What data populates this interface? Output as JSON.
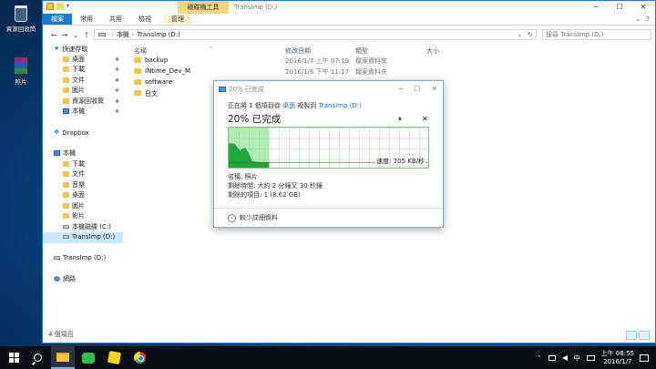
{
  "desktop": {
    "icons": [
      {
        "label": "資源回收筒"
      },
      {
        "label": "照片"
      }
    ]
  },
  "window": {
    "title": "TransImp (D:)",
    "context_tab": "磁碟機工具",
    "controls": {
      "minimize": "─",
      "maximize": "☐",
      "close": "✕"
    }
  },
  "ribbon": {
    "tabs": [
      "檔案",
      "常用",
      "共用",
      "檢視",
      "管理"
    ],
    "right": {
      "collapse": "⌄",
      "help": "?"
    }
  },
  "address_bar": {
    "back": "←",
    "forward": "→",
    "recent": "⌄",
    "up": "↑",
    "path": [
      "本機",
      "TransImp (D:)"
    ],
    "dropdown": "⌄",
    "refresh": "↻",
    "search_placeholder": "搜尋 TransImp (D:)"
  },
  "nav_pane": {
    "items": [
      {
        "label": "快速存取",
        "icon": "star",
        "pinned": false
      },
      {
        "label": "桌面",
        "icon": "folder",
        "pinned": true
      },
      {
        "label": "下載",
        "icon": "folder",
        "pinned": true
      },
      {
        "label": "文件",
        "icon": "folder",
        "pinned": true
      },
      {
        "label": "圖片",
        "icon": "folder",
        "pinned": true
      },
      {
        "label": "資源回收筒",
        "icon": "folder",
        "pinned": true
      },
      {
        "label": "本機",
        "icon": "pc",
        "pinned": true
      },
      {
        "label": "",
        "icon": "",
        "pinned": false
      },
      {
        "label": "Dropbox",
        "icon": "drop",
        "pinned": false
      },
      {
        "label": "",
        "icon": "",
        "pinned": false
      },
      {
        "label": "本機",
        "icon": "pc",
        "pinned": false
      },
      {
        "label": "下載",
        "icon": "folder",
        "pinned": false
      },
      {
        "label": "文件",
        "icon": "folder",
        "pinned": false
      },
      {
        "label": "音樂",
        "icon": "folder",
        "pinned": false
      },
      {
        "label": "桌面",
        "icon": "folder",
        "pinned": false
      },
      {
        "label": "圖片",
        "icon": "folder",
        "pinned": false
      },
      {
        "label": "影片",
        "icon": "folder",
        "pinned": false
      },
      {
        "label": "本機磁碟 (C:)",
        "icon": "drive",
        "pinned": false
      },
      {
        "label": "TransImp (D:)",
        "icon": "drive",
        "pinned": false,
        "selected": true
      },
      {
        "label": "",
        "icon": "",
        "pinned": false
      },
      {
        "label": "TransImp (D:)",
        "icon": "drive",
        "pinned": false
      },
      {
        "label": "",
        "icon": "",
        "pinned": false
      },
      {
        "label": "網路",
        "icon": "net",
        "pinned": false
      }
    ],
    "pin_glyph": "✱"
  },
  "file_list": {
    "columns": {
      "name": "名稱",
      "date": "修改日期",
      "type": "類型",
      "size": "大小"
    },
    "sort_glyph": "^",
    "rows": [
      {
        "name": "backup",
        "date": "2016/1/7 上午 07:19",
        "type": "檔案資料夾"
      },
      {
        "name": "INtime_Dev_M",
        "date": "2016/1/6 下午 11:17",
        "type": "檔案資料夾"
      },
      {
        "name": "software",
        "date": "",
        "type": ""
      },
      {
        "name": "日文",
        "date": "",
        "type": ""
      }
    ]
  },
  "status": {
    "items_count": "4 個項目"
  },
  "copy_dialog": {
    "title": "20% 已完成",
    "controls": {
      "minimize": "─",
      "maximize": "☐",
      "close": "✕"
    },
    "line1_prefix": "正在將 1 個項目從",
    "line1_from": "桌面",
    "line1_mid": "複製到",
    "line1_to": "TransImp (D:)",
    "progress_label": "20% 已完成",
    "progress": 0.2,
    "pause": "⏸",
    "cancel": "✕",
    "speed": "速度: 705 KB/秒",
    "name_line": "名稱: 照片",
    "time_line": "剩餘時間: 大約 2 分鐘又 30 秒鐘",
    "items_line": "剩餘的項目: 1 (8.62 GB)",
    "details_toggle": "⌄",
    "details_label": "較少詳細資料"
  },
  "taskbar": {
    "clock_time": "上午 08:55",
    "clock_date": "2016/1/7",
    "ime": "中",
    "tray_expand": "⌃",
    "apps": [
      {
        "name": "file-explorer"
      },
      {
        "name": "line"
      },
      {
        "name": "kakao"
      },
      {
        "name": "chrome"
      }
    ]
  }
}
